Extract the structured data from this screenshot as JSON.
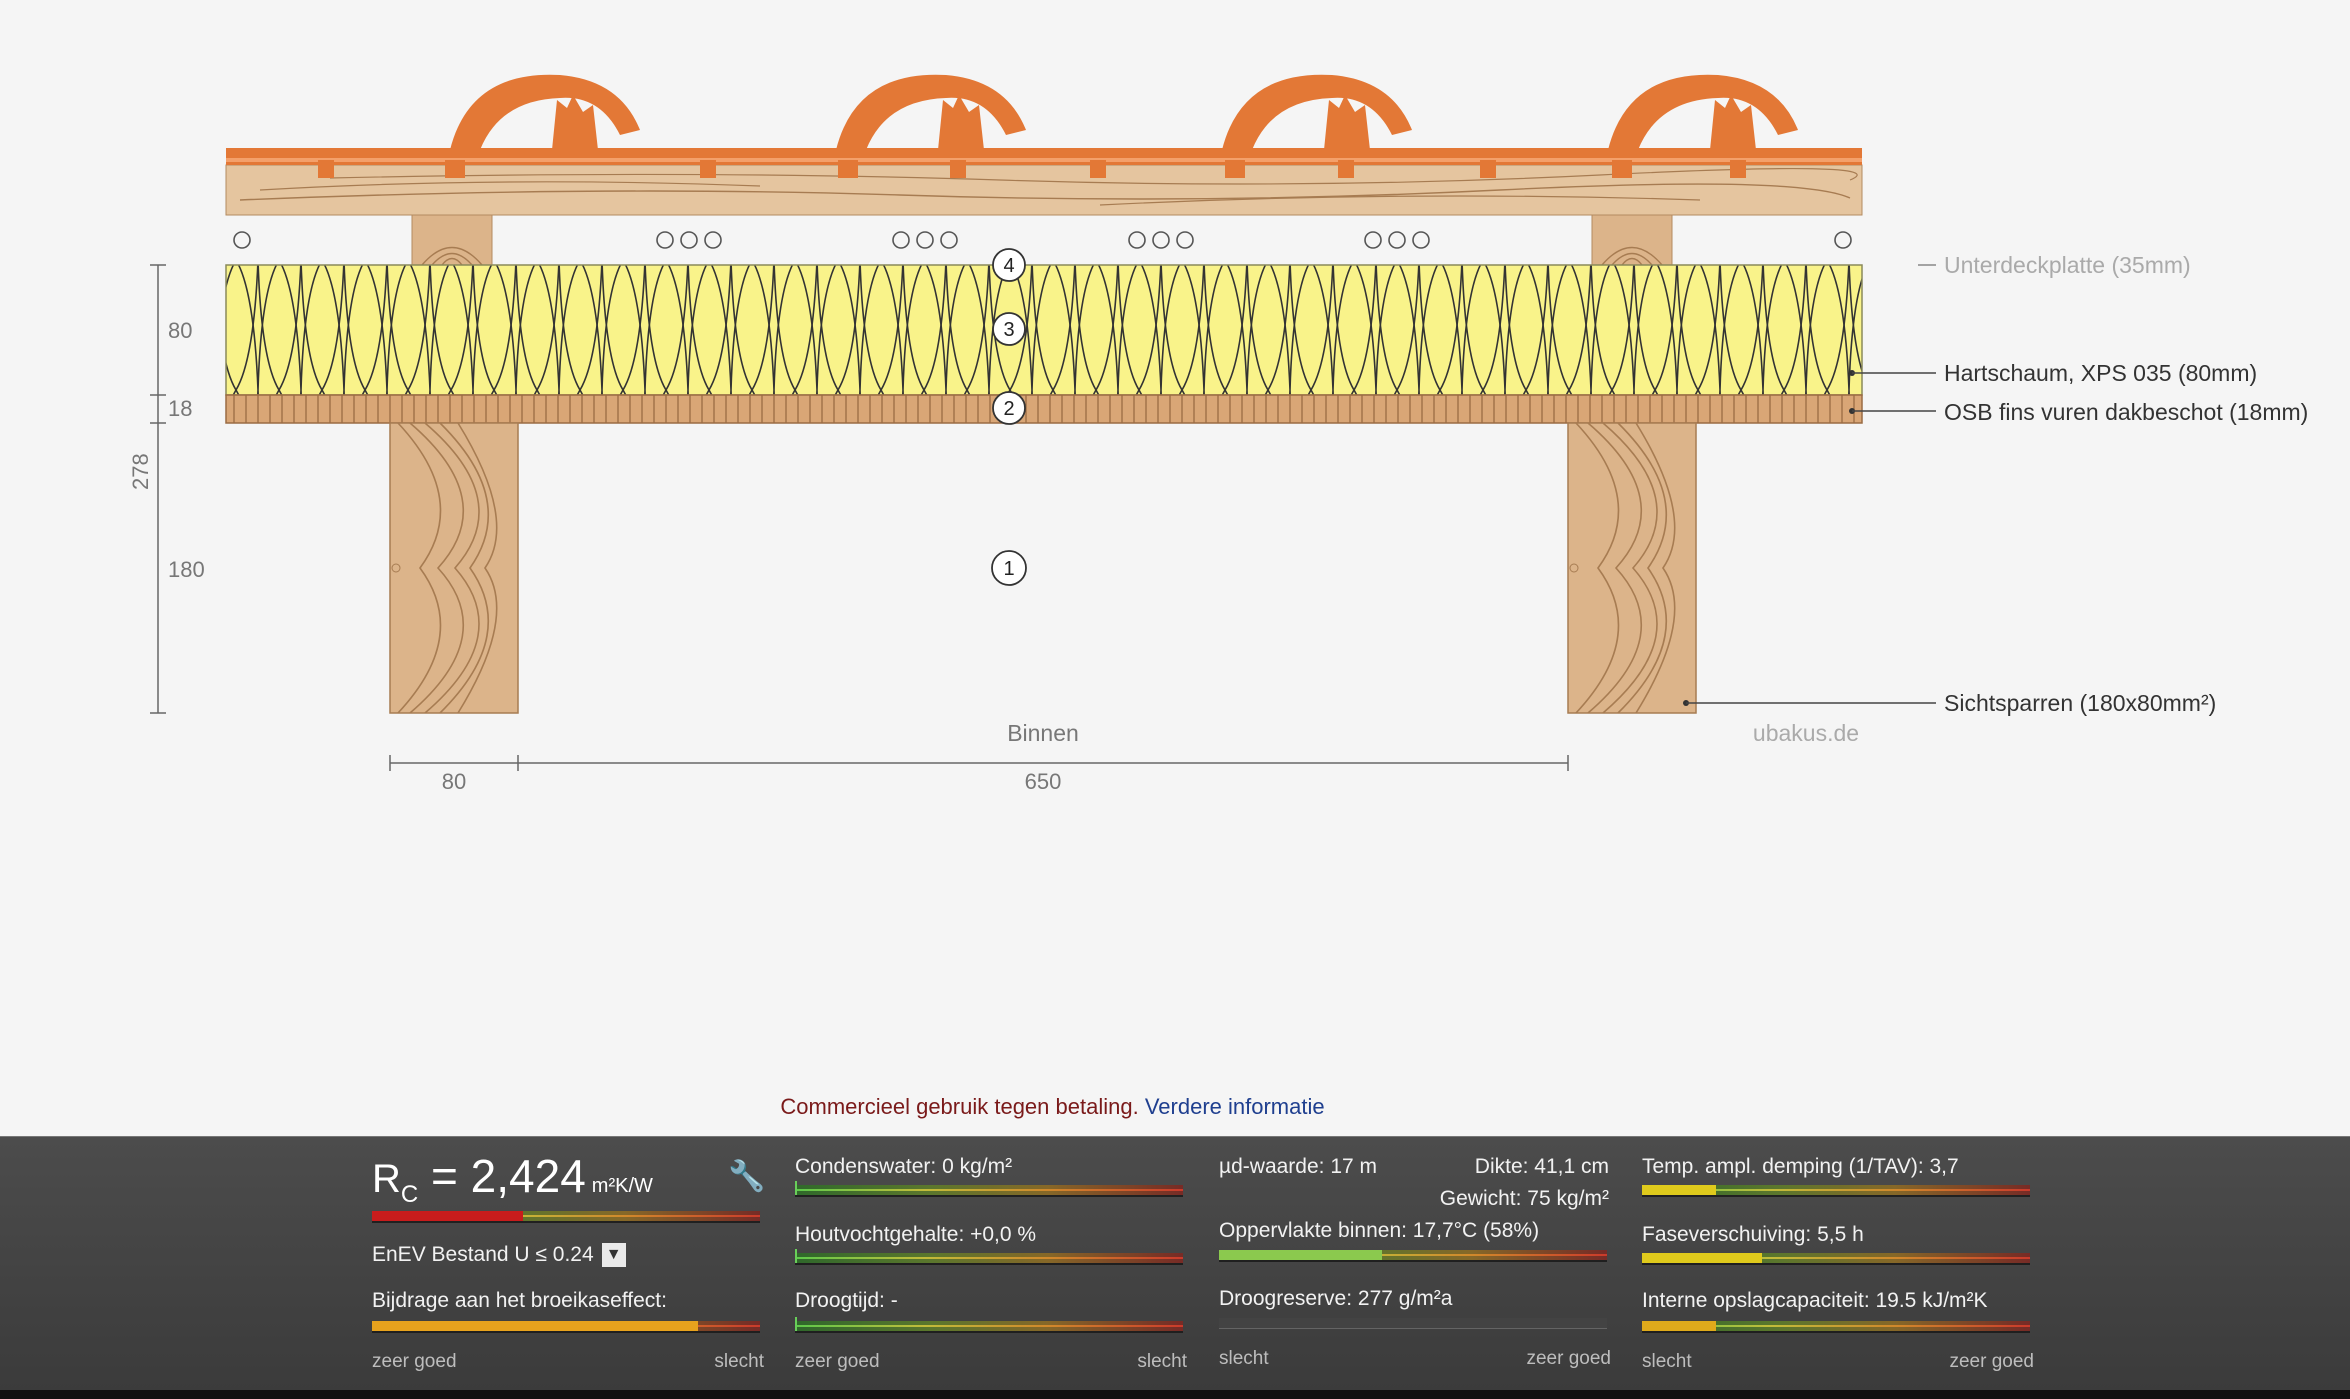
{
  "diagram": {
    "numbers": [
      "1",
      "2",
      "3",
      "4"
    ],
    "callouts": {
      "unterdeck": "Unterdeckplatte (35mm)",
      "xps": "Hartschaum, XPS 035 (80mm)",
      "osb": "OSB fins vuren dakbeschot (18mm)",
      "sparren": "Sichtsparren (180x80mm²)"
    },
    "dimensions": {
      "layer_80": "80",
      "layer_18": "18",
      "layer_180": "180",
      "total_278": "278",
      "width_80": "80",
      "width_650": "650"
    },
    "inside_label": "Binnen",
    "watermark": "ubakus.de"
  },
  "notice": {
    "text": "Commercieel gebruik tegen betaling.",
    "link": "Verdere informatie"
  },
  "panel": {
    "rc": {
      "symbol": "R",
      "subscript": "C",
      "equals": "=",
      "value": "2,424",
      "unit": "m²K/W",
      "fraction": 0.39,
      "color": "#d01a1a"
    },
    "enev": "EnEV Bestand U ≤ 0.24",
    "greenhouse": {
      "label": "Bijdrage aan het broeikaseffect:",
      "fraction": 0.84,
      "color": "#f0a81c"
    },
    "condensation": {
      "label": "Condenswater: 0 kg/m²"
    },
    "wood_moisture": {
      "label": "Houtvochtgehalte: +0,0 %"
    },
    "drying_time": {
      "label": "Droogtijd: -"
    },
    "sd_value": "µd-waarde: 17 m",
    "thickness": "Dikte: 41,1 cm",
    "weight": "Gewicht: 75 kg/m²",
    "surface_inside": {
      "label": "Oppervlakte binnen: 17,7°C (58%)",
      "fraction": 0.42,
      "color": "#8fd14f"
    },
    "drying_reserve": {
      "label": "Droogreserve: 277 g/m²a"
    },
    "temp_damping": {
      "label": "Temp. ampl. demping (1/TAV): 3,7",
      "fraction": 0.19,
      "color": "#e8d21a"
    },
    "phase_shift": {
      "label": "Faseverschuiving: 5,5 h",
      "fraction": 0.31,
      "color": "#e8d21a"
    },
    "storage": {
      "label": "Interne opslagcapaciteit: 19.5 kJ/m²K",
      "fraction": 0.19,
      "color": "#e8b01a"
    },
    "scales": {
      "good": "zeer goed",
      "bad": "slecht"
    }
  }
}
